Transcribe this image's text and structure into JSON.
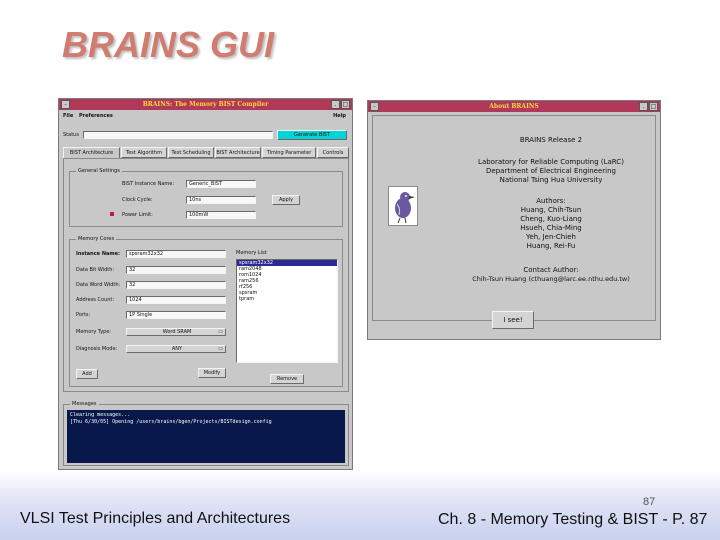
{
  "slide": {
    "title": "BRAINS GUI",
    "footer_left": "VLSI Test Principles and Architectures",
    "footer_right": "Ch. 8 - Memory Testing & BIST - P. 87",
    "page_number": "87"
  },
  "main_window": {
    "title": "BRAINS: The Memory BIST Compiler",
    "menu": {
      "file": "File",
      "preferences": "Preferences",
      "help": "Help"
    },
    "status_label": "Status",
    "status_value": "",
    "generate_button": "Generate BIST",
    "tabs": [
      "BIST Architecture",
      "Test Algorithm",
      "Test Scheduling",
      "BIST Architecture",
      "Timing Parameter",
      "Controls"
    ],
    "general": {
      "group_label": "General Settings",
      "bist_instance_label": "BIST Instance Name:",
      "bist_instance_value": "Generic_BIST",
      "clock_label": "Clock Cycle:",
      "clock_value": "10ns",
      "apply_button": "Apply",
      "power_label": "Power Limit:",
      "power_value": "100mW"
    },
    "memory": {
      "group_label": "Memory Cores",
      "instance_label": "Instance Name:",
      "instance_value": "spsram32x32",
      "data_width_label": "Data Bit Width:",
      "data_width_value": "32",
      "word_width_label": "Data Word Width:",
      "word_width_value": "32",
      "address_label": "Address Count:",
      "address_value": "1024",
      "ports_label": "Ports:",
      "ports_value": "1P Single",
      "mem_type_label": "Memory Type:",
      "mem_type_value": "Word SRAM",
      "diag_label": "Diagnosis Mode:",
      "diag_value": "ANY",
      "list_label": "Memory List",
      "list_items": [
        "spsram32x32",
        "ram2048",
        "rom1024",
        "ram256",
        "rf256",
        "spsram",
        "tpram"
      ],
      "selected_index": 0,
      "add_button": "Add",
      "modify_button": "Modify",
      "remove_button": "Remove"
    },
    "messages": {
      "group_label": "Messages",
      "lines": [
        "Clearing messages...",
        "[Thu 6/30/05] Opening /users/brains/bgen/Projects/BISTdesign.config"
      ]
    }
  },
  "about_window": {
    "title": "About BRAINS",
    "release": "BRAINS Release 2",
    "lab_lines": [
      "Laboratory for Reliable Computing (LaRC)",
      "Department of Electrical Engineering",
      "National Tsing Hua University"
    ],
    "authors_heading": "Authors:",
    "authors": [
      "Huang, Chih-Tsun",
      "Cheng, Kuo-Liang",
      "Hsueh, Chia-Ming",
      "Yeh, Jen-Chieh",
      "Huang, Rei-Fu"
    ],
    "contact_heading": "Contact Author:",
    "contact": "Chih-Tsun Huang (cthuang@larc.ee.nthu.edu.tw)",
    "close_button": "I see!"
  },
  "colors": {
    "title_accent": "#d07c70",
    "titlebar": "#b03858",
    "titlebar_text": "#ffd940",
    "window_bg": "#c8c8c8",
    "console_bg": "#08184a"
  }
}
